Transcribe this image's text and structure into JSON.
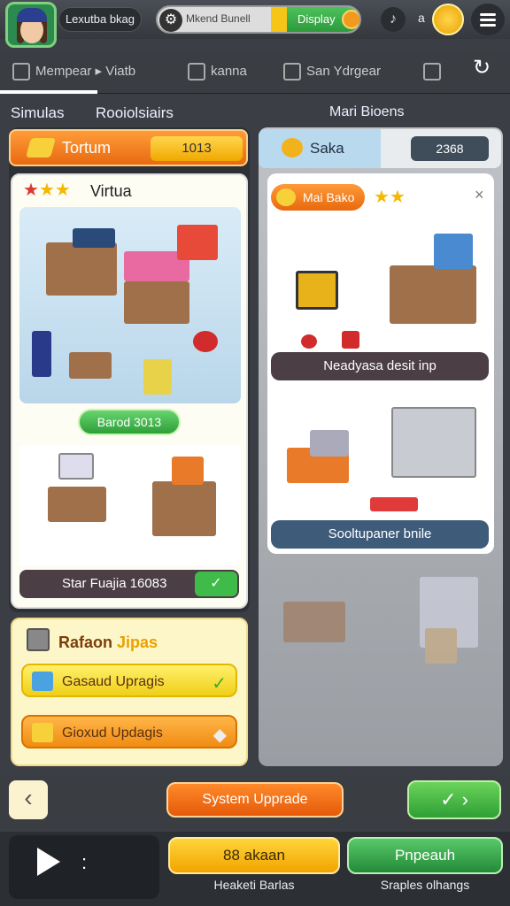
{
  "topbar": {
    "player_name": "Lexutba bkag",
    "search_text": "Mkend Bunell",
    "play_label": "Display",
    "harp_glyph": "♪",
    "a_label": "a"
  },
  "tabs": [
    {
      "label": "Mempear ▸ Viatb"
    },
    {
      "label": "kanna"
    },
    {
      "label": "San Ydrgear"
    }
  ],
  "sections": {
    "left": "Simulas",
    "mid": "Rooiolsiairs",
    "right": "Mari Bioens"
  },
  "left_panel": {
    "header_title": "Tortum",
    "header_value": "1013",
    "card_title": "Virtua",
    "bonus_label": "Barod 3013",
    "status_text": "Star Fuajia 16083",
    "status_check": "✓"
  },
  "upgrades": {
    "title_a": "Rafaon",
    "title_b": "Jipas",
    "items": [
      {
        "label": "Gasaud Upragis",
        "right": "✓"
      },
      {
        "label": "Gioxud Updagis",
        "right": "◆"
      }
    ]
  },
  "right_panel": {
    "header_title": "Saka",
    "header_value": "2368",
    "module_label": "Mai Bako",
    "close": "×",
    "status1": "Neadyasa desit inp",
    "status2": "Sooltupaner bnile"
  },
  "nav": {
    "back": "‹",
    "system_upgrade": "System Upprade",
    "ok": "✓ ›"
  },
  "bottom": {
    "dots": ":",
    "yellow_label": "88 akaan",
    "yellow_caption": "Heaketi Barlas",
    "green_label": "Pnpeauh",
    "green_caption": "Sraples olhangs"
  },
  "colors": {
    "orange": "#e86a10",
    "green": "#2f9f3a",
    "yellow": "#f0cf19",
    "panel_dark": "#2d3034"
  }
}
